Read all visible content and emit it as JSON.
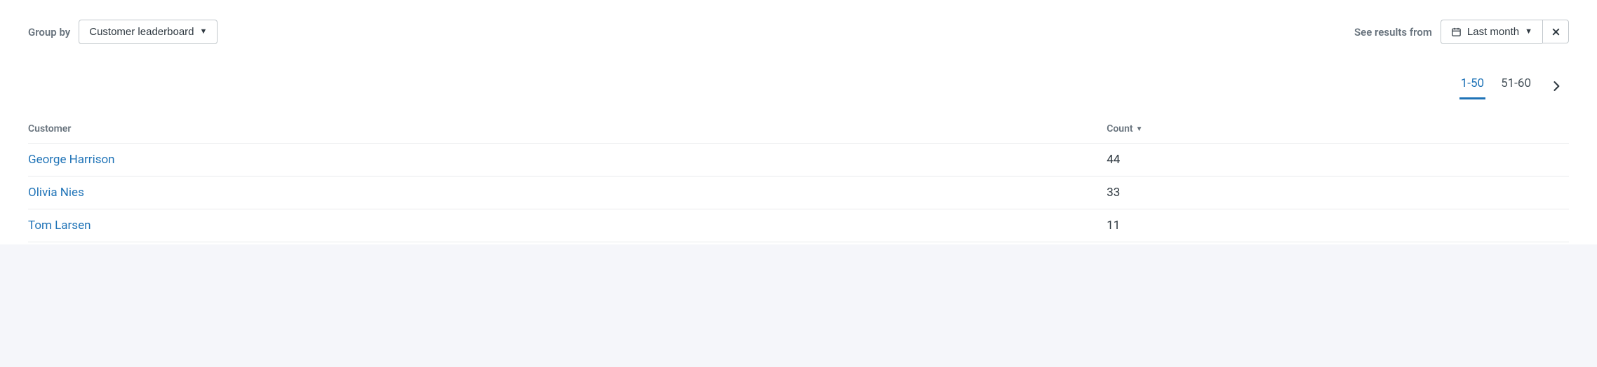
{
  "controls": {
    "group_by_label": "Group by",
    "group_by_value": "Customer leaderboard",
    "see_results_label": "See results from",
    "date_range_value": "Last month"
  },
  "pagination": {
    "ranges": [
      "1-50",
      "51-60"
    ],
    "active_index": 0
  },
  "table": {
    "headers": {
      "customer": "Customer",
      "count": "Count"
    },
    "rows": [
      {
        "customer": "George Harrison",
        "count": "44"
      },
      {
        "customer": "Olivia Nies",
        "count": "33"
      },
      {
        "customer": "Tom Larsen",
        "count": "11"
      }
    ]
  }
}
